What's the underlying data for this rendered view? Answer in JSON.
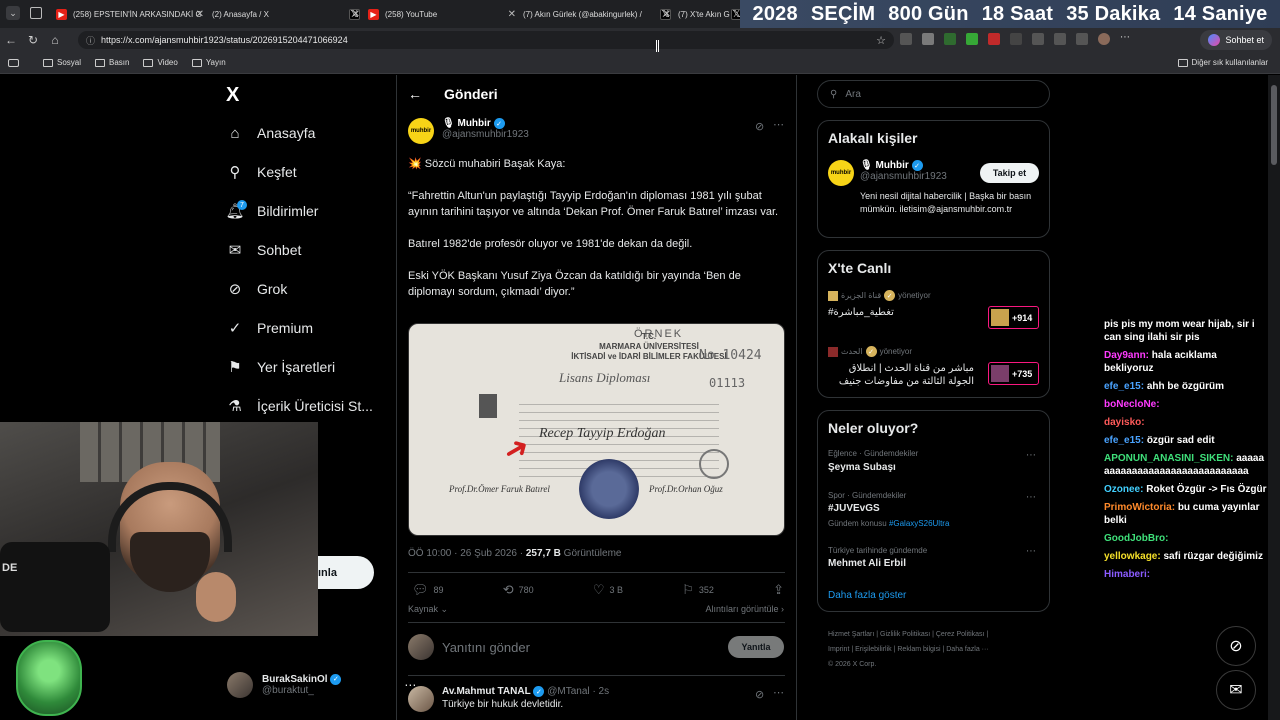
{
  "browser": {
    "tabs": [
      {
        "title": "(258) EPSTEIN'İN ARKASINDAKİ G",
        "favicon": "youtube-icon"
      },
      {
        "title": "(2) Anasayfa / X",
        "favicon": "x-icon"
      },
      {
        "title": "(258) YouTube",
        "favicon": "youtube-icon"
      },
      {
        "title": "(7) Akın Gürlek (@abakingurlek) /",
        "favicon": "x-icon"
      },
      {
        "title": "(7) X'te Akın G",
        "favicon": "x-icon"
      }
    ],
    "url": "https://x.com/ajansmuhbir1923/status/2026915204471066924",
    "copilot_label": "Sohbet et",
    "bookmarks": [
      "Sosyal",
      "Basın",
      "Video",
      "Yayın"
    ],
    "other_bookmarks": "Diğer sık kullanılanlar"
  },
  "countdown": {
    "year": "2028",
    "label": "SEÇİM",
    "days": "800 Gün",
    "hours": "18 Saat",
    "minutes": "35 Dakika",
    "seconds": "14 Saniye"
  },
  "nav": {
    "logo": "X",
    "items": [
      "Anasayfa",
      "Keşfet",
      "Bildirimler",
      "Sohbet",
      "Grok",
      "Premium",
      "Yer İşaretleri",
      "İçerik Üreticisi St..."
    ],
    "notif_badge": "7",
    "post_button_visible": "ınla",
    "profile_name": "BurakSakinOl",
    "profile_handle": "@buraktut_"
  },
  "webcam": {
    "mic_label": "DE"
  },
  "post": {
    "back_label": "←",
    "header": "Gönderi",
    "author_name": "Muhbir",
    "author_handle": "@ajansmuhbir1923",
    "logo_text": "muhbir",
    "paragraphs": [
      "💥 Sözcü muhabiri Başak Kaya:",
      "“Fahrettin Altun'un paylaştığı Tayyip Erdoğan'ın diploması 1981 yılı şubat ayının tarihini taşıyor ve altında ‘Dekan Prof. Ömer Faruk Batırel’ imzası var.",
      "Batırel 1982'de profesör oluyor ve 1981'de dekan da değil.",
      "Eski YÖK Başkanı Yusuf Ziya Özcan da katıldığı bir yayında ‘Ben de diplomayı sordum, çıkmadı’ diyor.”"
    ],
    "image": {
      "header_line1": "T.C.",
      "header_line2": "MARMARA ÜNİVERSİTESİ",
      "header_line3": "İKTİSADİ ve İDARİ BİLİMLER FAKÜLTESİ",
      "stamp": "ÖRNEK",
      "number1": "No 10424",
      "number2": "01113",
      "title": "Lisans Diploması",
      "name": "Recep Tayyip Erdoğan",
      "sig_left": "Prof.Dr.Ömer Faruk Batırel",
      "sig_right": "Prof.Dr.Orhan Oğuz"
    },
    "time": "ÖÖ 10:00 · 26 Şub 2026 ·",
    "views": "257,7 B",
    "views_label": "Görüntüleme",
    "replies": "89",
    "reposts": "780",
    "likes": "3 B",
    "bookmarks": "352",
    "source_label": "Kaynak",
    "quotes_label": "Alıntıları görüntüle ›",
    "reply_placeholder": "Yanıtını gönder",
    "reply_button": "Yanıtla"
  },
  "next_tweet": {
    "name": "Av.Mahmut TANAL",
    "handle": "@MTanal",
    "time": "· 2s",
    "text": "Türkiye bir hukuk devletidir."
  },
  "sidebar": {
    "search_placeholder": "Ara",
    "related_title": "Alakalı kişiler",
    "related_name": "Muhbir",
    "related_handle": "@ajansmuhbir1923",
    "follow_label": "Takip et",
    "bio": "Yeni nesil dijital habercilik | Başka bir basın mümkün. iletisim@ajansmuhbir.com.tr",
    "live_title": "X'te Canlı",
    "live": [
      {
        "channel": "قناة الجزيرة",
        "role": "yönetiyor",
        "title": "تغطية_مباشرة#",
        "count": "+914"
      },
      {
        "channel": "الحدث",
        "role": "yönetiyor",
        "title": "مباشر من قناة الحدث | انطلاق الجولة الثالثة من مفاوضات جنيف بين إيران",
        "count": "+735"
      }
    ],
    "trends_title": "Neler oluyor?",
    "trends": [
      {
        "category": "Eğlence · Gündemdekiler",
        "name": "Şeyma Subaşı",
        "sub": ""
      },
      {
        "category": "Spor · Gündemdekiler",
        "name": "#JUVEvGS",
        "sub_prefix": "Gündem konusu",
        "sub": "#GalaxyS26Ultra"
      },
      {
        "category": "Türkiye tarihinde gündemde",
        "name": "Mehmet Ali Erbil",
        "sub": ""
      }
    ],
    "show_more": "Daha fazla göster",
    "footer_line1": "Hizmet Şartları  |  Gizlilik Politikası  |  Çerez Politikası  |",
    "footer_line2": "Imprint  |  Erişilebilirlik  |  Reklam bilgisi  |  Daha fazla ···",
    "footer_line3": "© 2026 X Corp."
  },
  "chat": [
    {
      "user": "",
      "text": "pis pis my mom wear hijab, sir i can sing ilahi sir pis",
      "color": "#ffffff"
    },
    {
      "user": "Day9ann:",
      "text": "hala acıklama bekliyoruz",
      "color": "#ff3bff"
    },
    {
      "user": "efe_e15:",
      "text": "ahh be özgürüm",
      "color": "#4aa3ff"
    },
    {
      "user": "boNecloNe:",
      "text": "",
      "color": "#ff3bff"
    },
    {
      "user": "dayisko:",
      "text": "",
      "color": "#ff5a5a"
    },
    {
      "user": "efe_e15:",
      "text": "özgür sad edit",
      "color": "#4aa3ff"
    },
    {
      "user": "APONUN_ANASINI_SIKEN:",
      "text": "aaaaaaaaaaaaaaaaaaaaaaaaaaaaaaa",
      "color": "#3fe07a"
    },
    {
      "user": "Ozonee:",
      "text": "Roket Özgür -> Fıs Özgür",
      "color": "#42d0ff"
    },
    {
      "user": "PrimoWictoria:",
      "text": "bu cuma yayınlar belki",
      "color": "#ff8a2b"
    },
    {
      "user": "GoodJobBro:",
      "text": "",
      "color": "#3fe07a"
    },
    {
      "user": "yellowkage:",
      "text": "safi rüzgar değiğimiz",
      "color": "#f5e02a"
    },
    {
      "user": "Himaberi:",
      "text": "",
      "color": "#8a5bff"
    }
  ]
}
